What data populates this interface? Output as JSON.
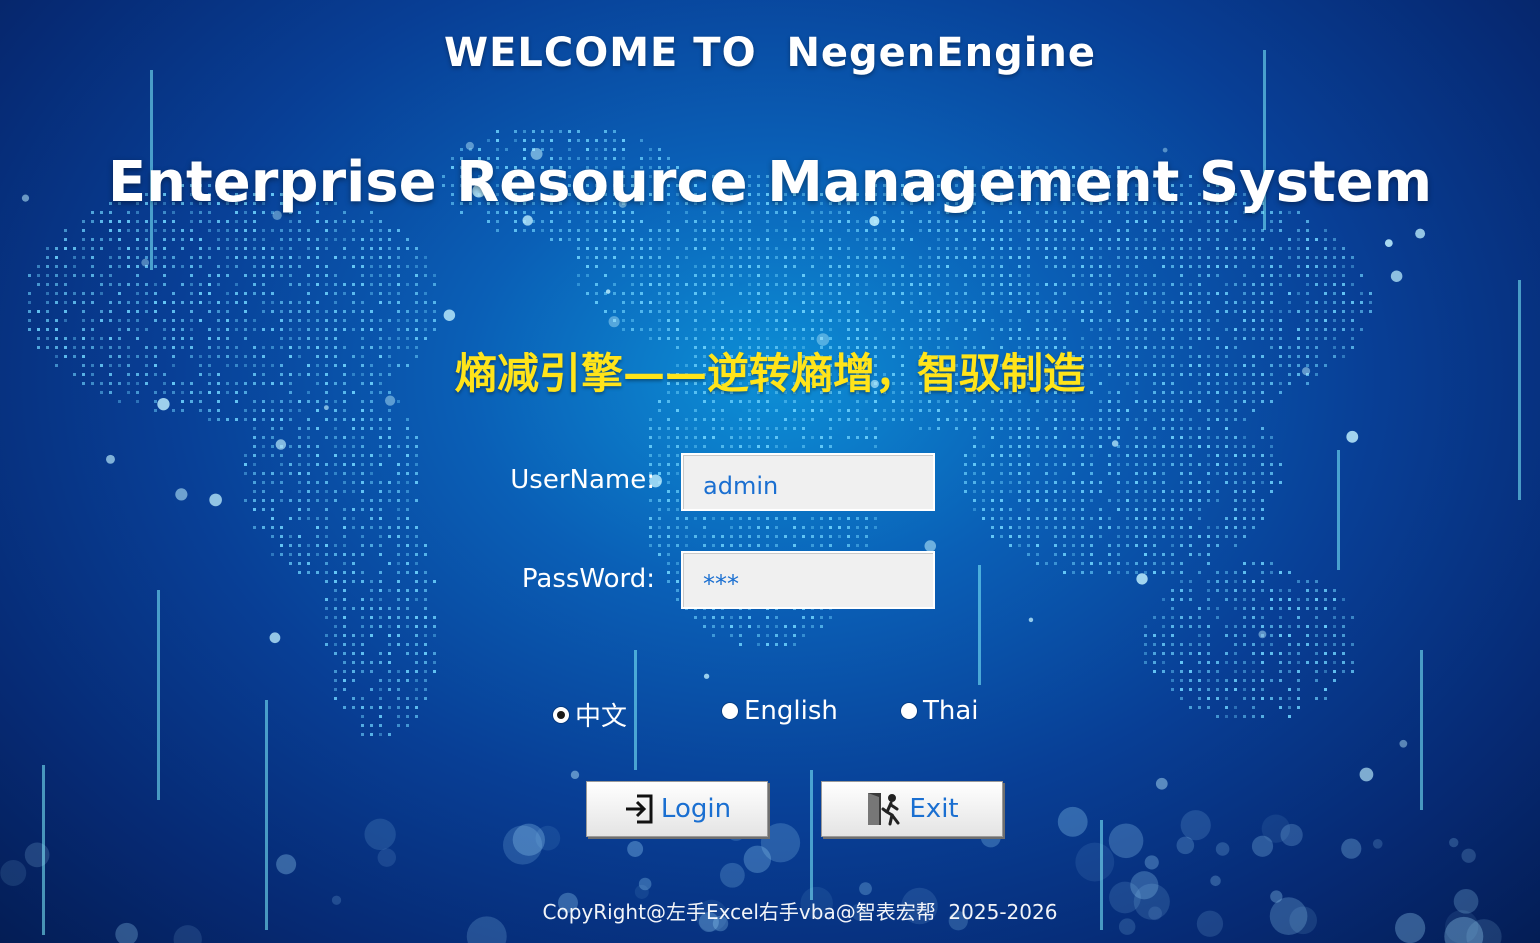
{
  "header": {
    "welcome": "WELCOME TO  NegenEngine",
    "system_title": "Enterprise Resource Management System",
    "slogan": "熵减引擎——逆转熵增，智驭制造"
  },
  "login_form": {
    "username_label": "UserName:",
    "username_value": "admin",
    "password_label": "PassWord:",
    "password_value": "***"
  },
  "language": {
    "options": [
      {
        "label": "中文",
        "selected": true
      },
      {
        "label": "English",
        "selected": false
      },
      {
        "label": "Thai",
        "selected": false
      }
    ]
  },
  "buttons": {
    "login_label": "Login",
    "login_icon": "sign-in-icon",
    "exit_label": "Exit",
    "exit_icon": "exit-door-icon"
  },
  "footer": {
    "copyright": "CopyRight@左手Excel右手vba@智表宏帮  2025-2026"
  },
  "colors": {
    "background": "#0a5fb6",
    "slogan": "#ffe41a",
    "input_text": "#1a6fd1",
    "button_text": "#1a6fd1"
  }
}
